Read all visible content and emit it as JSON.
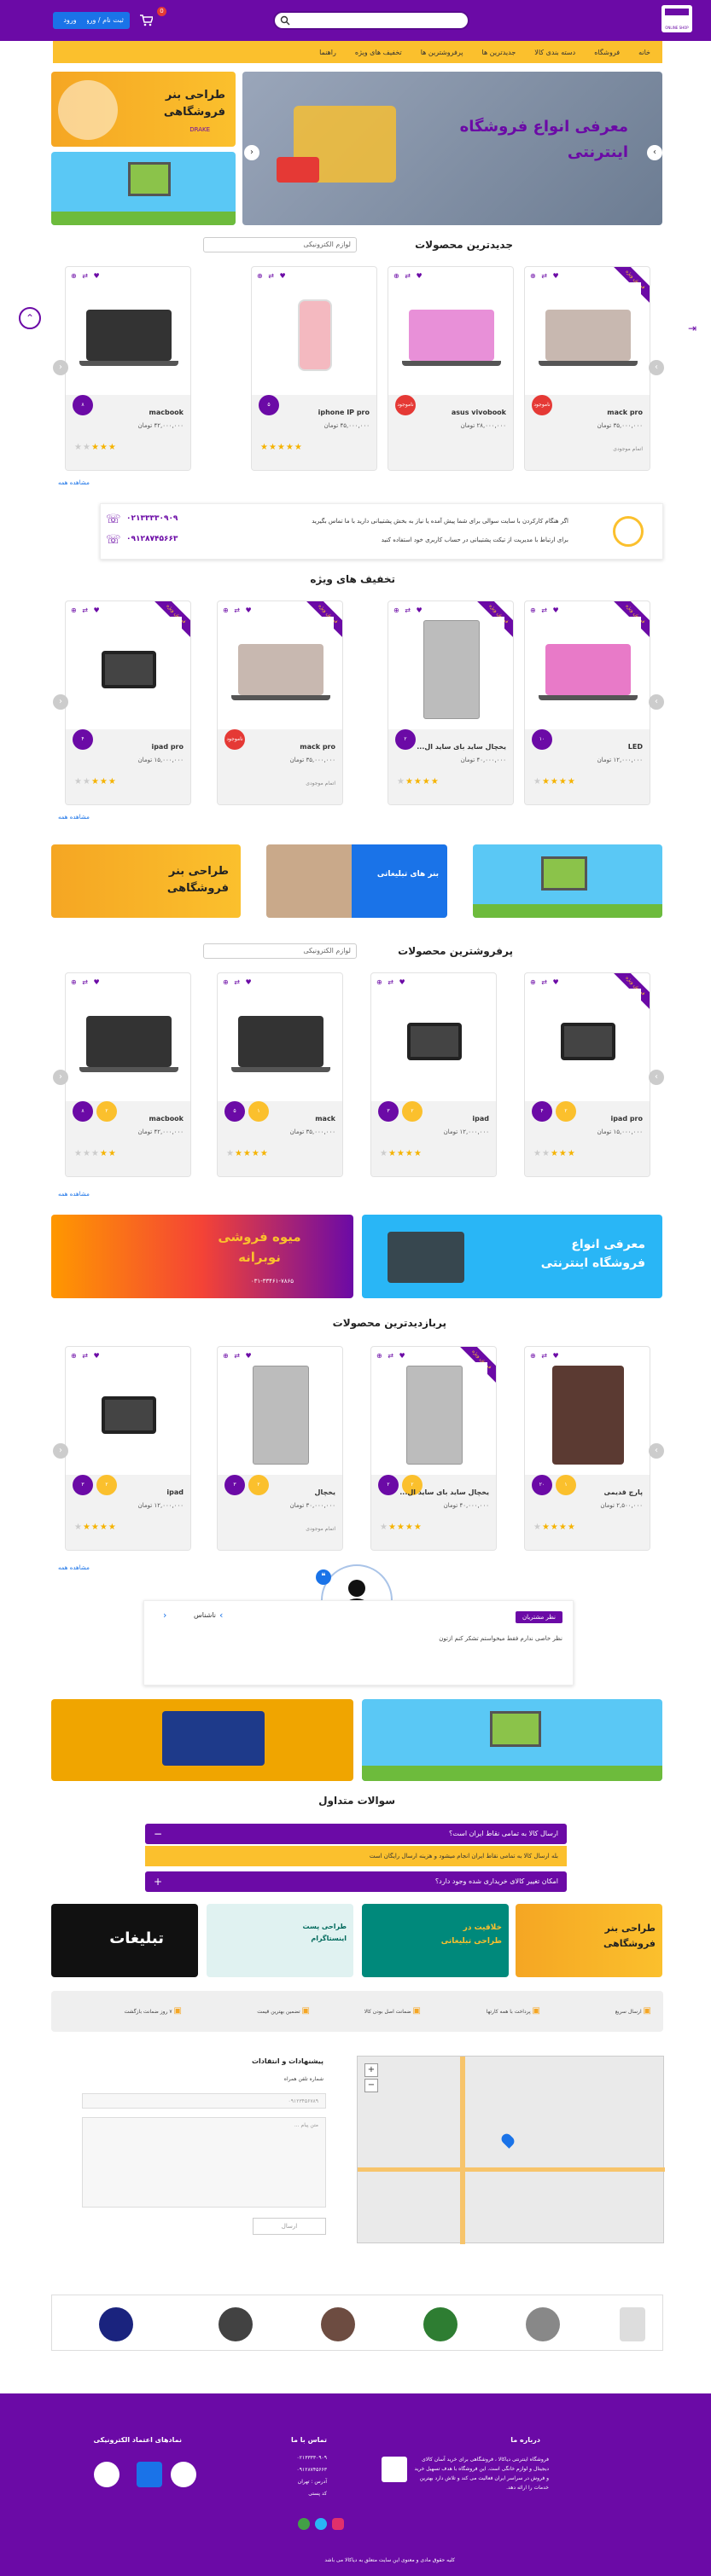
{
  "header": {
    "logo_text": "ONLINE SHOP",
    "search_placeholder": "",
    "login_button": "ثبت نام / ورود",
    "login_button2": "ورود",
    "cart_count": "0"
  },
  "nav": {
    "items": [
      "خانه",
      "فروشگاه",
      "دسته بندی کالا",
      "جدیدترین ها",
      "پرفروشترین ها",
      "تخفیف های ویژه",
      "راهنما"
    ]
  },
  "hero": {
    "main_text": "معرفی انواع فروشگاه اینترنتی",
    "side1_text": "طراحی بنر فروشگاهی",
    "side1_sub": "DRAKE"
  },
  "sections": {
    "newest": "جدیدترین محصولات",
    "discount": "تخفیف های ویژه",
    "bestseller": "پرفروشترین محصولات",
    "popular": "پربازدیدترین محصولات",
    "faq": "سوالات متداول"
  },
  "select_value": "لوازم الکترونیکی",
  "see_all": "مشاهده همه",
  "newest_products": [
    {
      "name": "mack pro",
      "price": "۳۵,۰۰۰,۰۰۰ تومان",
      "badge": "ناموجود",
      "stock": "اتمام موجودی",
      "ribbon": "فروش ویژه",
      "rating": 0
    },
    {
      "name": "asus vivobook",
      "price": "۲۸,۰۰۰,۰۰۰ تومان",
      "badge": "ناموجود",
      "stock": "",
      "ribbon": "",
      "rating": 0
    },
    {
      "name": "iphone IP pro",
      "price": "۴۵,۰۰۰,۰۰۰ تومان",
      "badge": "۵",
      "stock": "",
      "ribbon": "",
      "rating": 0
    },
    {
      "name": "macbook",
      "price": "۴۲,۰۰۰,۰۰۰ تومان",
      "badge": "۸",
      "stock": "",
      "ribbon": "",
      "rating": 3
    }
  ],
  "contact": {
    "line1": "اگر هنگام کارکردن با سایت سوالی برای شما پیش آمده یا نیاز به بخش پشتیبانی دارید با ما تماس بگیرید",
    "line2": "برای ارتباط با مدیریت از تیکت پشتیبانی در حساب کاربری خود استفاده کنید",
    "phone1": "۰۲۱۳۳۳۳۰۹۰۹",
    "phone2": "۰۹۱۲۸۷۴۵۶۶۳"
  },
  "discount_products": [
    {
      "name": "LED",
      "price": "۱۲,۰۰۰,۰۰۰ تومان",
      "badge": "۱۰",
      "stock": "",
      "ribbon": "فروش ویژه",
      "rating": 4
    },
    {
      "name": "یخچال ساید بای ساید ال...",
      "price": "۴۰,۰۰۰,۰۰۰ تومان",
      "badge": "۲",
      "stock": "",
      "ribbon": "فروش ویژه",
      "rating": 4
    },
    {
      "name": "mack pro",
      "price": "۳۵,۰۰۰,۰۰۰ تومان",
      "badge": "ناموجود",
      "stock": "اتمام موجودی",
      "ribbon": "فروش ویژه",
      "rating": 0
    },
    {
      "name": "ipad pro",
      "price": "۱۵,۰۰۰,۰۰۰ تومان",
      "badge": "۴",
      "stock": "",
      "ribbon": "فروش ویژه",
      "rating": 3
    }
  ],
  "mid_banners": {
    "left": "طراحی بنر فروشگاهی",
    "center": "بنر های تبلیغاتی"
  },
  "bestseller_products": [
    {
      "name": "ipad pro",
      "price": "۱۵,۰۰۰,۰۰۰ تومان",
      "badge": "۴",
      "badge2": "۲",
      "stock": "",
      "ribbon": "فروش ویژه",
      "rating": 3
    },
    {
      "name": "ipad",
      "price": "۱۲,۰۰۰,۰۰۰ تومان",
      "badge": "۳",
      "badge2": "۲",
      "stock": "",
      "ribbon": "",
      "rating": 4
    },
    {
      "name": "mack",
      "price": "۳۵,۰۰۰,۰۰۰ تومان",
      "badge": "۵",
      "badge2": "۱",
      "stock": "",
      "ribbon": "",
      "rating": 4
    },
    {
      "name": "macbook",
      "price": "۴۲,۰۰۰,۰۰۰ تومان",
      "badge": "۸",
      "badge2": "۲",
      "stock": "",
      "ribbon": "",
      "rating": 2
    }
  ],
  "promo": {
    "left_title": "میوه فروشی نوبرانه",
    "left_phone": "۰۳۱-۳۳۴۶۱-۷۸۶۵",
    "right_title": "معرفی انواع فروشگاه اینترنتی"
  },
  "popular_products": [
    {
      "name": "پارچ قدیمی",
      "price": "۲,۵۰۰,۰۰۰ تومان",
      "badge": "۲۰",
      "badge2": "۱",
      "stock": "",
      "ribbon": "",
      "rating": 4
    },
    {
      "name": "یخچال ساید بای ساید ال...",
      "price": "۴۰,۰۰۰,۰۰۰ تومان",
      "badge": "۲",
      "badge2": "۲",
      "stock": "",
      "ribbon": "فروش ویژه",
      "rating": 4
    },
    {
      "name": "یخچال",
      "price": "۳۰,۰۰۰,۰۰۰ تومان",
      "badge": "۳",
      "badge2": "۲",
      "stock": "اتمام موجودی",
      "ribbon": "",
      "rating": 0
    },
    {
      "name": "ipad",
      "price": "۱۲,۰۰۰,۰۰۰ تومان",
      "badge": "۳",
      "badge2": "۲",
      "stock": "",
      "ribbon": "",
      "rating": 4
    }
  ],
  "testimonial": {
    "tag": "نظر مشتریان",
    "name": "ناشناس",
    "text": "نظر خاصی ندارم فقط میخواستم تشکر کنم ازتون"
  },
  "faq": [
    {
      "q": "ارسال کالا به تمامی نقاط ایران است؟",
      "a": "بله ارسال کالا به تمامی نقاط ایران انجام میشود و هزینه ارسال رایگان است"
    },
    {
      "q": "امکان تغییر کالای خریداری شده وجود دارد؟",
      "a": ""
    }
  ],
  "ads": {
    "a1": "طراحی بنر فروشگاهی",
    "a2": "خلاقیت در طراحی تبلیغاتی",
    "a3": "طراحی پست اینستاگرام",
    "a4": "تبلیغات"
  },
  "features": [
    "ارسال سریع",
    "پرداخت با همه کارتها",
    "تضمین بهترین قیمت",
    "ضمانت اصل بودن کالا",
    "تضمین بهترین قیمت",
    "۷ روز ضمانت بازگشت"
  ],
  "contact_form": {
    "title": "پیشنهادات و انتقادات",
    "phone_label": "شماره تلفن همراه",
    "phone_placeholder": "۰۹۱۲۳۴۵۶۷۸۹",
    "msg_placeholder": "متن پیام ...",
    "send": "ارسال"
  },
  "footer": {
    "about_title": "درباره ما",
    "about_text": "فروشگاه اینترنتی دیاکالا ، فروشگاهی برای خرید آسان کالای دیجیتال و لوازم خانگی است. این فروشگاه با هدف تسهیل خرید و فروش در سراسر ایران فعالیت می کند و تلاش دارد بهترین خدمات را ارائه دهد.",
    "contact_title": "تماس با ما",
    "phone1": "۰۲۱۳۳۳۳۰۹۰۹",
    "phone2": "۰۹۱۲۸۷۴۵۶۶۳",
    "address": "آدرس : تهران",
    "address2": "کد پستی",
    "trust_title": "نمادهای اعتماد الکترونیکی",
    "copyright": "کلیه حقوق مادی و معنوی این سایت متعلق به دیاکالا می باشد"
  },
  "colors": {
    "primary": "#6b0aa6",
    "accent": "#fbc02d",
    "blue": "#1a73e8",
    "red": "#e53935"
  }
}
